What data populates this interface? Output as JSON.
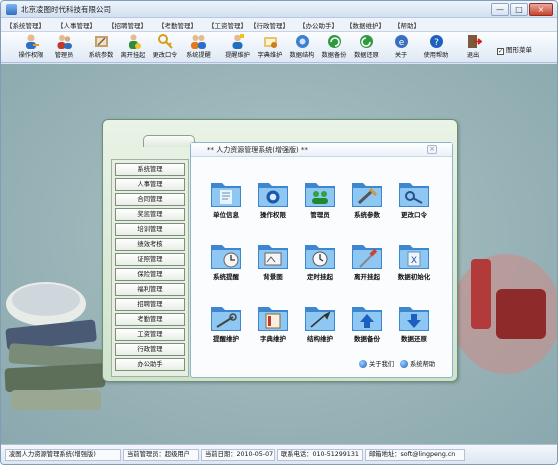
{
  "window": {
    "title": "北京凌图时代科技有限公司",
    "minimize": "—",
    "maximize": "□",
    "close": "×"
  },
  "menu": [
    "【系统管理】",
    "【人事管理】",
    "【招聘管理】",
    "【考勤管理】",
    "【工资管理】",
    "【行政管理】",
    "【办公助手】",
    "【数据维护】",
    "【帮助】"
  ],
  "toolbar": {
    "buttons": [
      {
        "label": "操作权限",
        "icon": "user-key-icon"
      },
      {
        "label": "管理员",
        "icon": "admin-users-icon"
      },
      {
        "label": "系统参数",
        "icon": "settings-tools-icon"
      },
      {
        "label": "离开挂起",
        "icon": "away-user-icon"
      },
      {
        "label": "更改口令",
        "icon": "key-password-icon"
      },
      {
        "label": "系统提醒",
        "icon": "reminder-people-icon"
      },
      {
        "label": "提醒维护",
        "icon": "reminder-maintain-icon"
      },
      {
        "label": "字典维护",
        "icon": "dictionary-icon"
      },
      {
        "label": "数据结构",
        "icon": "data-structure-icon"
      },
      {
        "label": "数据备份",
        "icon": "backup-icon"
      },
      {
        "label": "数据还原",
        "icon": "restore-icon"
      },
      {
        "label": "关于",
        "icon": "about-icon"
      },
      {
        "label": "使用帮助",
        "icon": "help-icon"
      },
      {
        "label": "退出",
        "icon": "exit-icon"
      }
    ],
    "checkbox_label": "图形菜单",
    "checkbox_mark": "✓"
  },
  "nav": [
    "系统管理",
    "人事管理",
    "合同管理",
    "奖惩管理",
    "培训管理",
    "绩效考核",
    "证照管理",
    "保险管理",
    "福利管理",
    "招聘管理",
    "考勤管理",
    "工资管理",
    "行政管理",
    "办公助手"
  ],
  "panel": {
    "title": "** 人力资源管理系统(增强版) **",
    "close": "×",
    "modules": [
      {
        "label": "单位信息",
        "icon": "company-info-icon"
      },
      {
        "label": "操作权限",
        "icon": "permission-icon"
      },
      {
        "label": "管理员",
        "icon": "admin-icon"
      },
      {
        "label": "系统参数",
        "icon": "system-params-icon"
      },
      {
        "label": "更改口令",
        "icon": "change-password-icon"
      },
      {
        "label": "系统提醒",
        "icon": "system-reminder-icon"
      },
      {
        "label": "背景图",
        "icon": "background-image-icon"
      },
      {
        "label": "定时挂起",
        "icon": "timed-suspend-icon"
      },
      {
        "label": "离开挂起",
        "icon": "leave-suspend-icon"
      },
      {
        "label": "数据初始化",
        "icon": "data-init-icon"
      },
      {
        "label": "提醒维护",
        "icon": "reminder-maintenance-icon"
      },
      {
        "label": "字典维护",
        "icon": "dictionary-maintenance-icon"
      },
      {
        "label": "结构维护",
        "icon": "structure-maintenance-icon"
      },
      {
        "label": "数据备份",
        "icon": "data-backup-icon"
      },
      {
        "label": "数据还原",
        "icon": "data-restore-icon"
      }
    ],
    "about": "关于我们",
    "help": "系统帮助"
  },
  "status": {
    "app": "凌图人力资源管理系统(增强版)",
    "user": "当前管理员：超级用户",
    "date": "当前日期：2010-05-07",
    "phone": "联系电话：010-51299131",
    "email": "邮箱地址：soft@lingpeng.cn"
  },
  "colors": {
    "folder": "#5e9fd9",
    "folder_light": "#9fd0f6",
    "panel_border": "#6c8e74",
    "desktop": "#9db7ba"
  }
}
